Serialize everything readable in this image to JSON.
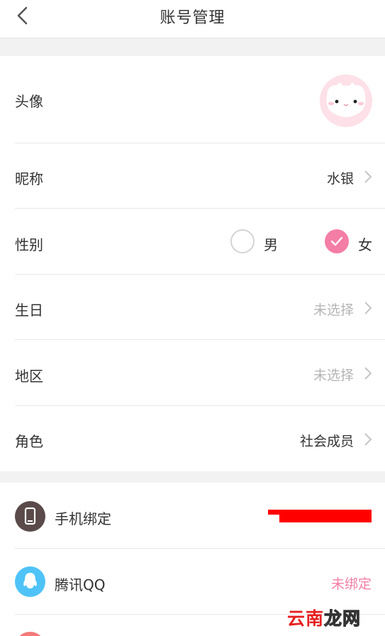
{
  "nav": {
    "title": "账号管理"
  },
  "profile": {
    "avatar_label": "头像",
    "nickname_label": "昵称",
    "nickname_value": "水银",
    "gender_label": "性别",
    "gender_options": [
      "男",
      "女"
    ],
    "gender_selected": "女",
    "birthday_label": "生日",
    "birthday_value": "未选择",
    "region_label": "地区",
    "region_value": "未选择",
    "role_label": "角色",
    "role_value": "社会成员"
  },
  "bindings": {
    "phone_label": "手机绑定",
    "qq_label": "腾讯QQ",
    "qq_status": "未绑定"
  },
  "watermark": {
    "text_a": "云南",
    "text_b": "龙网"
  },
  "colors": {
    "accent": "#f47ea5",
    "qq": "#4fc3f7",
    "phone": "#5a4a4a",
    "redaction": "#ff0000"
  }
}
